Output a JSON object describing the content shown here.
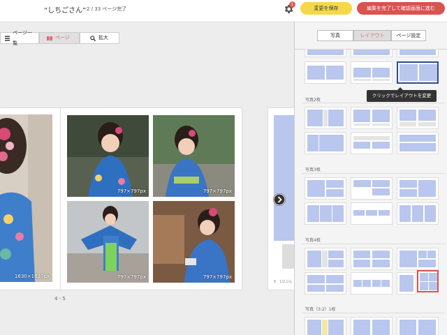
{
  "header": {
    "title": "“しちごさん”",
    "progress": "2 / 33 ページ完了",
    "notification_count": "1",
    "save_label": "変更を保存",
    "finish_label": "編集を完了して確認画面に進む"
  },
  "toolbar": {
    "page_list": "ページ一覧",
    "page": "ページ",
    "zoom": "拡大"
  },
  "canvas": {
    "photos": [
      {
        "label": "1630×1630px"
      },
      {
        "label": "797×797px"
      },
      {
        "label": "797×797px"
      },
      {
        "label": "797×797px"
      },
      {
        "label": "797×797px"
      }
    ],
    "page_number": "4 - 5",
    "next_page_text": "6　1/2ぶん"
  },
  "panel": {
    "tabs": [
      "写真",
      "レイアウト",
      "ページ設定"
    ],
    "active_tab": "レイアウト",
    "tooltip": "クリックでレイアウトを変更",
    "sections": [
      "写真2枚",
      "写真3枚",
      "写真4枚",
      "写真（3:2）1枚"
    ]
  },
  "colors": {
    "accent_red": "#d9534f",
    "save_yellow": "#f5d84a",
    "layout_blue": "#b9c7ee"
  }
}
